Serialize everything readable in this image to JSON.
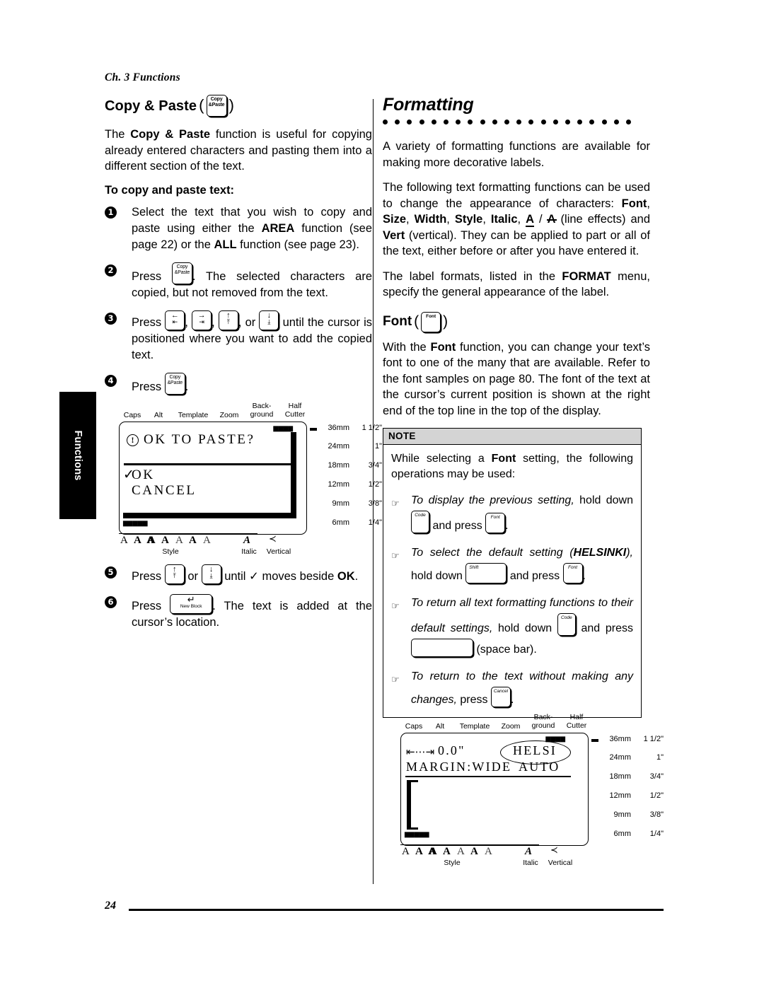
{
  "meta": {
    "running_head": "Ch. 3 Functions",
    "page_number": "24",
    "side_tab": "Functions"
  },
  "left_column": {
    "heading": "Copy & Paste",
    "heading_key": {
      "line1": "Copy",
      "line2": "&Paste",
      "name": "copy-paste-key"
    },
    "intro": {
      "p1_a": "The ",
      "p1_b": "Copy & Paste",
      "p1_c": " function is useful for copying already entered characters and pasting them into a different section of the text."
    },
    "procedure_title": "To copy and paste text:",
    "steps": [
      {
        "num": "1",
        "segments": [
          {
            "t": "Select the text that you wish to copy and paste using either the ",
            "b": false
          },
          {
            "t": "AREA",
            "b": true
          },
          {
            "t": " function (see page 22) or the ",
            "b": false
          },
          {
            "t": "ALL",
            "b": true
          },
          {
            "t": " function (see page 23).",
            "b": false
          }
        ]
      },
      {
        "num": "2",
        "pre": "Press ",
        "post": ". The selected characters are copied, but not removed from the text."
      },
      {
        "num": "3",
        "pre": "Press ",
        "mid1": ", ",
        "mid2": ", ",
        "mid3": ", or ",
        "post": " until the cursor is positioned where you want to add the copied text."
      },
      {
        "num": "4",
        "pre": "Press ",
        "post": "."
      },
      {
        "num": "5",
        "pre": "Press ",
        "mid1": " or ",
        "post_a": " until ",
        "check": "✓",
        "post_b": " moves beside ",
        "post_bold": "OK",
        "post_c": "."
      },
      {
        "num": "6",
        "pre": "Press ",
        "post": ". The text is added at the cursor’s location."
      }
    ],
    "keys": {
      "arrow_left": {
        "primary": "←",
        "secondary": "⇤",
        "name": "cursor-left-key"
      },
      "arrow_right": {
        "primary": "→",
        "secondary": "⇥",
        "name": "cursor-right-key"
      },
      "arrow_up": {
        "primary": "↑",
        "secondary": "⤒",
        "name": "cursor-up-key"
      },
      "arrow_down": {
        "primary": "↓",
        "secondary": "⤓",
        "name": "cursor-down-key"
      },
      "new_block": {
        "primary": "↵",
        "secondary": "New Block",
        "name": "new-block-key"
      }
    }
  },
  "right_column": {
    "chapter_heading": "Formatting",
    "dot_count": 21,
    "p1": "A variety of formatting functions are available for making more decorative labels.",
    "p2": {
      "segments": [
        {
          "t": "The following text formatting functions can be used to change the appearance of characters: ",
          "b": false
        },
        {
          "t": "Font",
          "b": true
        },
        {
          "t": ", ",
          "b": false
        },
        {
          "t": "Size",
          "b": true
        },
        {
          "t": ", ",
          "b": false
        },
        {
          "t": "Width",
          "b": true
        },
        {
          "t": ", ",
          "b": false
        },
        {
          "t": "Style",
          "b": true
        },
        {
          "t": ", ",
          "b": false
        },
        {
          "t": "Italic",
          "b": true
        },
        {
          "t": ", ",
          "b": false
        }
      ],
      "glyph_underline_a": "A",
      "glyph_slash": " / ",
      "glyph_strike_a": "A",
      "tail_a": " (line effects) and ",
      "tail_bold": "Vert",
      "tail_b": " (vertical). They can be applied to part or all of the text, either before or after you have entered it."
    },
    "p3": {
      "a": "The label formats, listed in the ",
      "bold": "FORMAT",
      "b": " menu, specify the general appearance of the label."
    },
    "font_heading": "Font",
    "font_key": {
      "label": "Font",
      "name": "font-key"
    },
    "p4": {
      "a": "With the ",
      "bold": "Font",
      "b": " function, you can change your text’s font to one of the many that are available. Refer to the font samples on page 80. The font of the text at the cursor’s current position is shown at the right end of the top line in the top of the display."
    },
    "note": {
      "header": "NOTE",
      "intro_a": "While selecting a ",
      "intro_bold": "Font",
      "intro_b": " setting, the following operations may be used:",
      "bullet_glyph": "☞",
      "items": [
        {
          "it_a": "To display the previous setting,",
          "rm_a": " hold down ",
          "key1": "Code",
          "rm_b": " and press ",
          "key2": "Font",
          "rm_c": "."
        },
        {
          "it_a": "To select the default setting (",
          "it_bold": "HELSINKI",
          "it_b": "),",
          "rm_a": " hold down ",
          "key1": "Shift",
          "rm_b": " and press ",
          "key2": "Font",
          "rm_c": "."
        },
        {
          "it_a": "To return all text formatting functions to their default settings,",
          "rm_a": " hold down ",
          "key1": "Code",
          "rm_b": " and press ",
          "key2": "",
          "rm_c": " (space bar)."
        },
        {
          "it_a": "To return to the text without making any changes,",
          "rm_a": " press ",
          "key1": "Cancel",
          "rm_c": "."
        }
      ]
    }
  },
  "lcd_figures": [
    {
      "name": "lcd-ok-to-paste",
      "indicators_top": [
        "Caps",
        "Alt",
        "Template",
        "Zoom",
        "Back-ground",
        "Half Cutter"
      ],
      "line1": "OK TO PASTE?",
      "warn_icon": "!",
      "menu_items": [
        "OK",
        "CANCEL"
      ],
      "check": "✓",
      "battery": "▆▆▆▆▆",
      "tape_marker": "▆▆▆▆",
      "dash": true,
      "scale": [
        {
          "mm": "36mm",
          "in": "1 1/2\""
        },
        {
          "mm": "24mm",
          "in": "1\""
        },
        {
          "mm": "18mm",
          "in": "3/4\""
        },
        {
          "mm": "12mm",
          "in": "1/2\""
        },
        {
          "mm": "9mm",
          "in": "3/8\""
        },
        {
          "mm": "6mm",
          "in": "1/4\""
        }
      ],
      "style_letters": [
        "A",
        "A",
        "A",
        "A",
        "A",
        "A",
        "A"
      ],
      "indicators_bottom": [
        "Style",
        "Italic",
        "Vertical"
      ],
      "italic_letter": "A",
      "vertical_glyph": "≺"
    },
    {
      "name": "lcd-margin-wide-helsinki",
      "indicators_top": [
        "Caps",
        "Alt",
        "Template",
        "Zoom",
        "Back-ground",
        "Half Cutter"
      ],
      "margin_arrow": "⇤⋯⇥",
      "length_value": "0.0\"",
      "font_value": "HELSI",
      "line2_left": "MARGIN:WIDE",
      "line2_right": "AUTO",
      "battery": "▆▆▆▆▆",
      "tape_marker": "▆▆▆▆",
      "dash": true,
      "scale": [
        {
          "mm": "36mm",
          "in": "1 1/2\""
        },
        {
          "mm": "24mm",
          "in": "1\""
        },
        {
          "mm": "18mm",
          "in": "3/4\""
        },
        {
          "mm": "12mm",
          "in": "1/2\""
        },
        {
          "mm": "9mm",
          "in": "3/8\""
        },
        {
          "mm": "6mm",
          "in": "1/4\""
        }
      ],
      "style_letters": [
        "A",
        "A",
        "A",
        "A",
        "A",
        "A",
        "A"
      ],
      "indicators_bottom": [
        "Style",
        "Italic",
        "Vertical"
      ],
      "italic_letter": "A",
      "vertical_glyph": "≺"
    }
  ]
}
